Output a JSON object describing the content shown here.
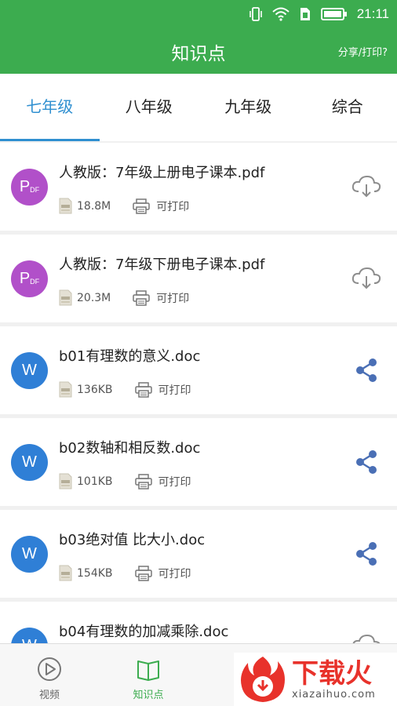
{
  "status_bar": {
    "time": "21:11"
  },
  "app_bar": {
    "title": "知识点",
    "share_label": "分享/打印?"
  },
  "tabs": [
    {
      "label": "七年级",
      "active": true
    },
    {
      "label": "八年级",
      "active": false
    },
    {
      "label": "九年级",
      "active": false
    },
    {
      "label": "综合",
      "active": false
    }
  ],
  "items": [
    {
      "type": "pdf",
      "avatar_main": "P",
      "avatar_sub": "DF",
      "name": "人教版：7年级上册电子课本.pdf",
      "size": "18.8M",
      "print": "可打印",
      "action": "cloud-download-icon"
    },
    {
      "type": "pdf",
      "avatar_main": "P",
      "avatar_sub": "DF",
      "name": "人教版：7年级下册电子课本.pdf",
      "size": "20.3M",
      "print": "可打印",
      "action": "cloud-download-icon"
    },
    {
      "type": "doc",
      "avatar_main": "W",
      "name": "b01有理数的意义.doc",
      "size": "136KB",
      "print": "可打印",
      "action": "share-icon"
    },
    {
      "type": "doc",
      "avatar_main": "W",
      "name": "b02数轴和相反数.doc",
      "size": "101KB",
      "print": "可打印",
      "action": "share-icon"
    },
    {
      "type": "doc",
      "avatar_main": "W",
      "name": "b03绝对值 比大小.doc",
      "size": "154KB",
      "print": "可打印",
      "action": "share-icon"
    },
    {
      "type": "doc",
      "avatar_main": "W",
      "name": "b04有理数的加减乘除.doc",
      "size": "",
      "print": "",
      "action": "cloud-download-icon"
    }
  ],
  "bottom_nav": [
    {
      "label": "视频",
      "icon": "play-circle-icon",
      "active": false
    },
    {
      "label": "知识点",
      "icon": "book-icon",
      "active": true
    }
  ],
  "watermark": {
    "cn": "下载火",
    "en": "xiazaihuo.com"
  },
  "colors": {
    "primary": "#3cac4f",
    "tab_active": "#2f8fd0",
    "pdf": "#b150c9",
    "doc": "#2f7fd6",
    "share": "#4a6fb5"
  }
}
